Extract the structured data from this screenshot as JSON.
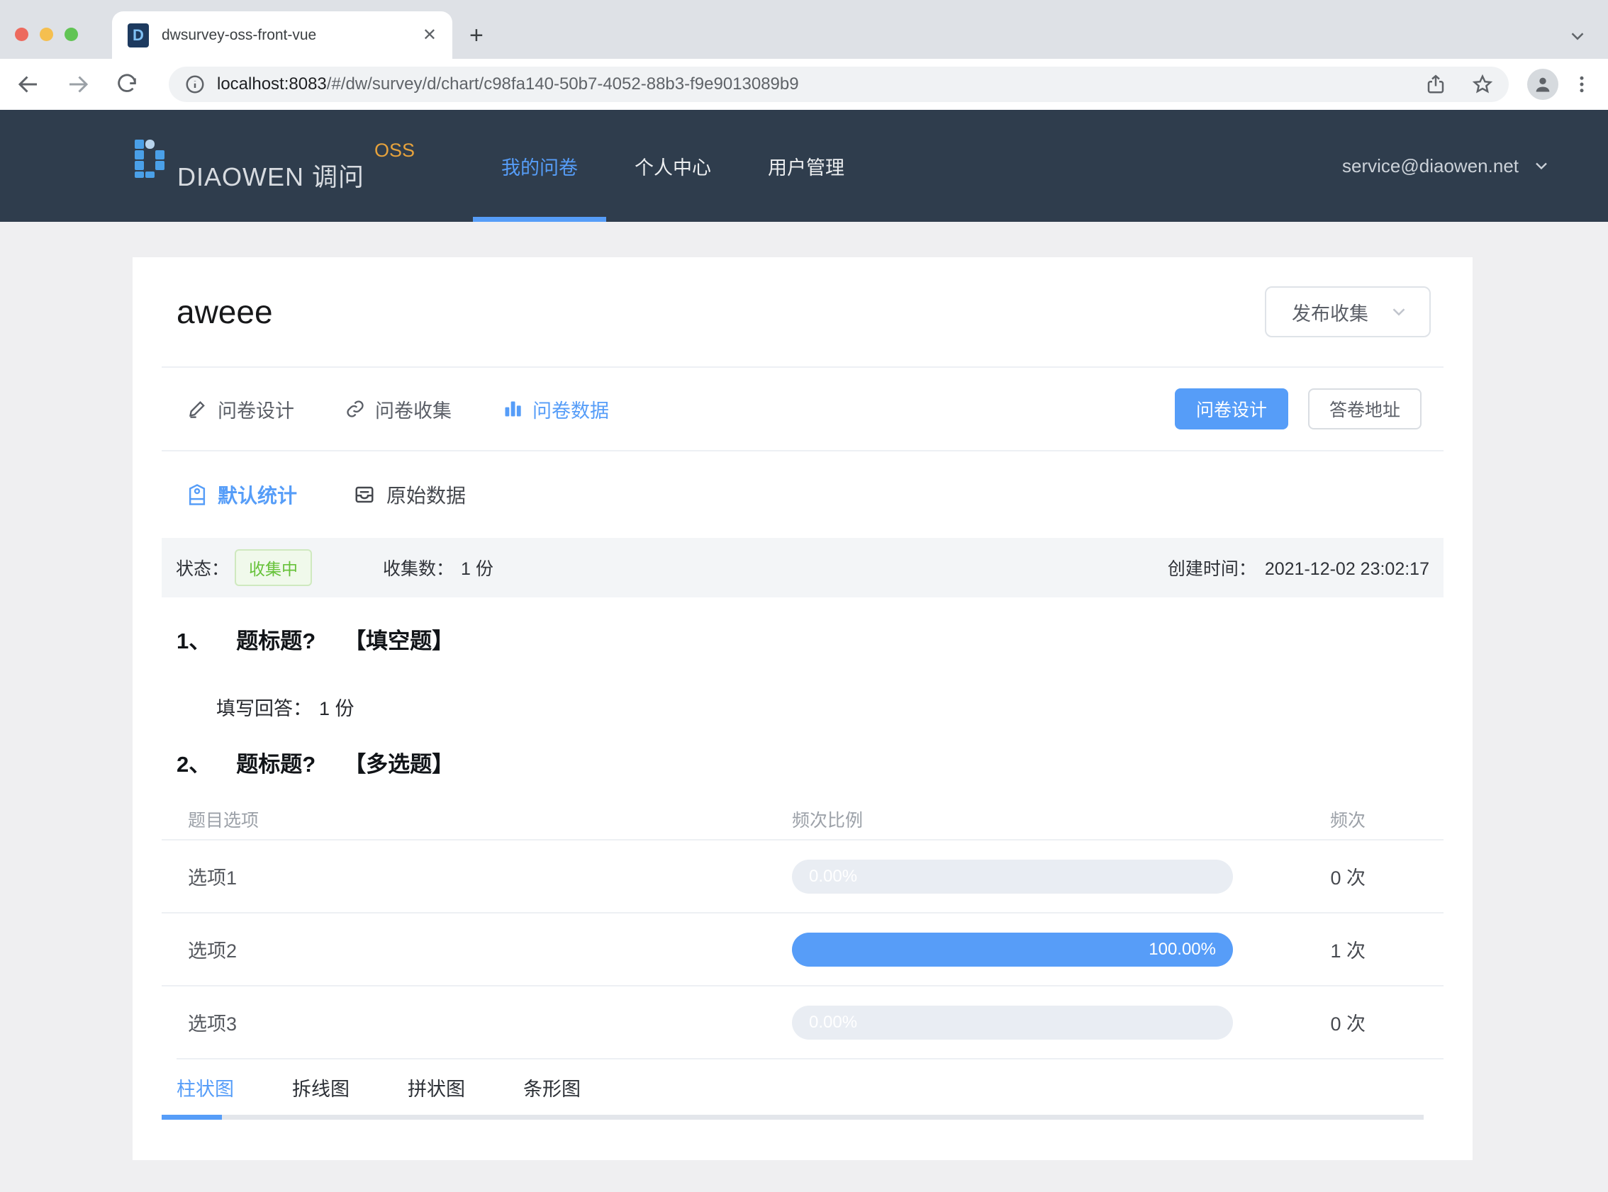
{
  "browser": {
    "tab_title": "dwsurvey-oss-front-vue",
    "favicon_letter": "D",
    "url_host": "localhost:8083",
    "url_path": "/#/dw/survey/d/chart/c98fa140-50b7-4052-88b3-f9e9013089b9"
  },
  "header": {
    "brand": "DIAOWEN 调问",
    "brand_badge": "OSS",
    "nav": [
      {
        "label": "我的问卷",
        "active": true
      },
      {
        "label": "个人中心",
        "active": false
      },
      {
        "label": "用户管理",
        "active": false
      }
    ],
    "account": "service@diaowen.net"
  },
  "survey": {
    "title": "aweee",
    "publish_select_value": "发布收集",
    "tabs": [
      {
        "label": "问卷设计",
        "icon": "edit-icon",
        "active": false
      },
      {
        "label": "问卷收集",
        "icon": "link-icon",
        "active": false
      },
      {
        "label": "问卷数据",
        "icon": "bar-chart-icon",
        "active": true
      }
    ],
    "design_button": "问卷设计",
    "answer_url_button": "答卷地址",
    "stat_tabs": [
      {
        "label": "默认统计",
        "icon": "tag-icon",
        "active": true
      },
      {
        "label": "原始数据",
        "icon": "inbox-icon",
        "active": false
      }
    ],
    "status": {
      "label": "状态：",
      "badge": "收集中",
      "count_label": "收集数：",
      "count_value": "1 份",
      "created_label": "创建时间：",
      "created_value": "2021-12-02 23:02:17"
    }
  },
  "question1": {
    "no": "1、",
    "title": "题标题?",
    "type": "【填空题】",
    "answer_label": "填写回答：",
    "answer_value": "1 份"
  },
  "question2": {
    "no": "2、",
    "title": "题标题?",
    "type": "【多选题】",
    "headers": {
      "option": "题目选项",
      "ratio": "频次比例",
      "freq": "频次"
    },
    "rows": [
      {
        "option": "选项1",
        "percent": "0.00%",
        "percent_value": 0,
        "count": "0 次"
      },
      {
        "option": "选项2",
        "percent": "100.00%",
        "percent_value": 100,
        "count": "1 次"
      },
      {
        "option": "选项3",
        "percent": "0.00%",
        "percent_value": 0,
        "count": "0 次"
      }
    ]
  },
  "chart_data": {
    "type": "bar",
    "categories": [
      "选项1",
      "选项2",
      "选项3"
    ],
    "series": [
      {
        "name": "频次比例(%)",
        "values": [
          0,
          100,
          0
        ]
      },
      {
        "name": "频次",
        "values": [
          0,
          1,
          0
        ]
      }
    ],
    "title": "题标题? 【多选题】",
    "xlabel": "题目选项",
    "ylabel": "频次比例",
    "ylim": [
      0,
      100
    ]
  },
  "chart_tabs": [
    {
      "label": "柱状图",
      "active": true
    },
    {
      "label": "拆线图",
      "active": false
    },
    {
      "label": "拼状图",
      "active": false
    },
    {
      "label": "条形图",
      "active": false
    }
  ],
  "colors": {
    "accent_blue": "#569df8",
    "header_bg": "#2f3d4d",
    "badge_green": "#67c23a",
    "badge_green_bg": "#f0f9eb",
    "bar_track": "#e9edf3",
    "brand_badge_orange": "#e6a23c"
  }
}
